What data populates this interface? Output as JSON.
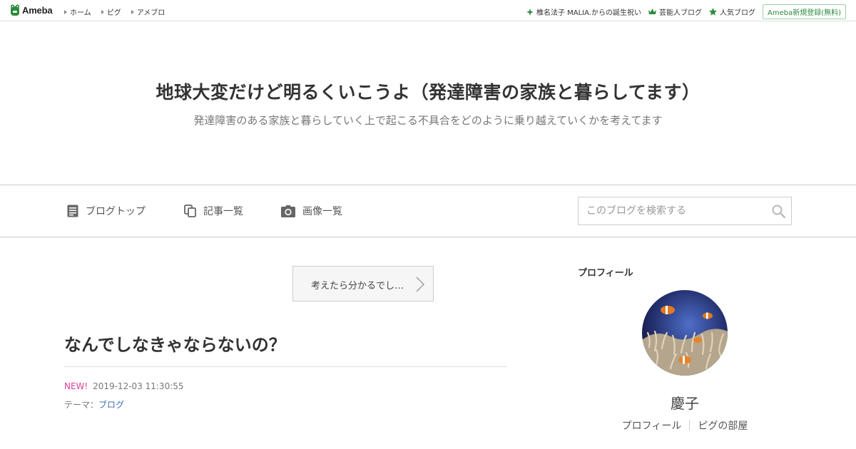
{
  "topbar": {
    "logo_text": "Ameba",
    "nav": [
      "ホーム",
      "ピグ",
      "アメブロ"
    ],
    "right_links": [
      "椎名法子 MALIA.からの誕生祝い",
      "芸能人ブログ",
      "人気ブログ"
    ],
    "register_label": "Ameba新規登録(無料)"
  },
  "blog": {
    "title": "地球大変だけど明るくいこうよ（発達障害の家族と暮らしてます）",
    "subtitle": "発達障害のある家族と暮らしていく上で起こる不具合をどのように乗り越えていくかを考えてます"
  },
  "blog_nav": {
    "items": [
      "ブログトップ",
      "記事一覧",
      "画像一覧"
    ],
    "search_placeholder": "このブログを検索する"
  },
  "article": {
    "prev_label": "考えたら分かるでし…",
    "title": "なんでしなきゃならないの？",
    "new_badge": "NEW!",
    "timestamp": "2019-12-03 11:30:55",
    "theme_label": "テーマ：",
    "theme_link": "ブログ"
  },
  "sidebar": {
    "heading": "プロフィール",
    "author_name": "慶子",
    "links": [
      "プロフィール",
      "ピグの部屋"
    ]
  },
  "colors": {
    "ameba_green": "#2d8a3e",
    "new_pink": "#d6409f",
    "link_blue": "#3a6fb0"
  },
  "icons": {
    "logo": "ameba-frog-icon",
    "topnav_caret": "caret-right-icon",
    "right_1": "sparkle-icon",
    "right_2": "crown-icon",
    "right_3": "star-icon",
    "nav_1": "document-icon",
    "nav_2": "copy-icon",
    "nav_3": "camera-icon",
    "search": "search-icon",
    "prev": "chevron-right-icon"
  }
}
